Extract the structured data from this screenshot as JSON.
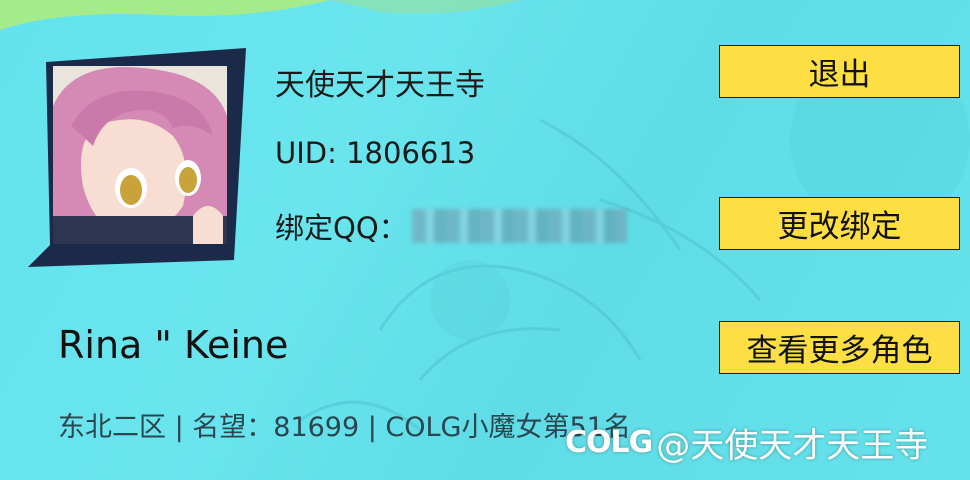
{
  "profile": {
    "username": "天使天才天王寺",
    "uid": "UID: 1806613",
    "qq_label": "绑定QQ："
  },
  "buttons": {
    "logout": "退出",
    "rebind": "更改绑定",
    "more_roles": "查看更多角色"
  },
  "character": {
    "name": "Rina \" Keine",
    "info": "东北二区 | 名望：81699 | COLG小魔女第51名"
  },
  "watermark": {
    "logo": "COLG",
    "handle": "@天使天才天王寺"
  },
  "colors": {
    "background": "#63e3ee",
    "button_bg": "#fddf43",
    "frame_dark": "#1c2a4a"
  },
  "icons": {
    "avatar": "anime-girl-avatar"
  }
}
